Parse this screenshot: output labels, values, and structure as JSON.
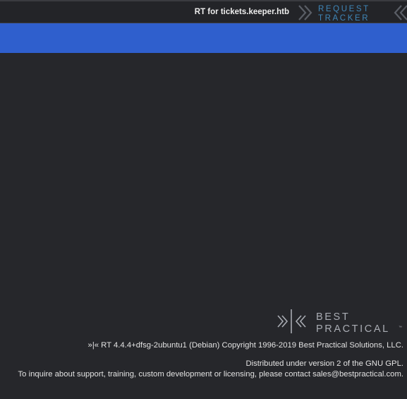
{
  "header": {
    "site_title": "RT for tickets.keeper.htb",
    "logo_line1": "REQUEST",
    "logo_line2": "TRACKER",
    "logo_icon": "chevrons-logo-icon"
  },
  "colors": {
    "menu_bar": "#2f5fcd",
    "background": "#26272b",
    "logo_blue": "#3f86b8"
  },
  "footer": {
    "brand_line1": "BEST",
    "brand_line2": "PRACTICAL",
    "brand_tm": "™",
    "version_text": "»|« RT 4.4.4+dfsg-2ubuntu1 (Debian) Copyright 1996-2019 Best Practical Solutions, LLC.",
    "license_text": "Distributed under version 2 of the GNU GPL.",
    "contact_text": "To inquire about support, training, custom development or licensing, please contact sales@bestpractical.com."
  }
}
